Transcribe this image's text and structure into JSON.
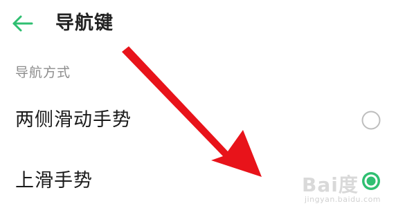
{
  "header": {
    "back_icon": "arrow-left-icon",
    "title": "导航键"
  },
  "section": {
    "label": "导航方式"
  },
  "options": [
    {
      "label": "两侧滑动手势",
      "selected": false
    },
    {
      "label": "上滑手势",
      "selected": true
    }
  ],
  "colors": {
    "accent": "#2fbf71",
    "radio_border": "#bdbdbd",
    "annotation_arrow": "#e8131a"
  },
  "watermark": {
    "logo": "Bai度",
    "url": "jingyan.baidu.com"
  }
}
